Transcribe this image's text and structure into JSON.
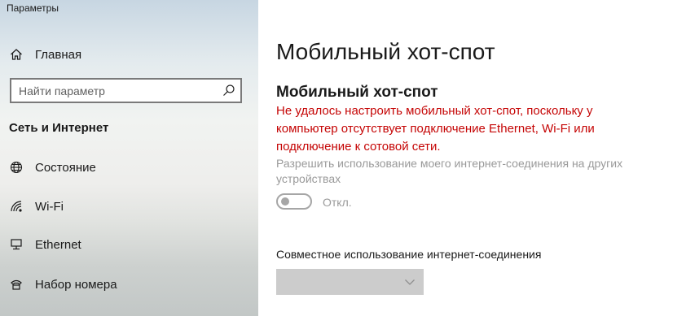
{
  "window": {
    "title": "Параметры"
  },
  "sidebar": {
    "home_label": "Главная",
    "search": {
      "placeholder": "Найти параметр",
      "value": ""
    },
    "section_heading": "Сеть и Интернет",
    "items": [
      {
        "label": "Состояние",
        "icon": "globe-icon"
      },
      {
        "label": "Wi-Fi",
        "icon": "wifi-icon"
      },
      {
        "label": "Ethernet",
        "icon": "ethernet-icon"
      },
      {
        "label": "Набор номера",
        "icon": "dialup-icon"
      }
    ]
  },
  "main": {
    "page_title": "Мобильный хот-спот",
    "section_title": "Мобильный хот-спот",
    "error_message": "Не удалось настроить мобильный хот-спот, поскольку у компьютер отсутствует подключение Ethernet, Wi-Fi или подключение к сотовой сети.",
    "share_description": "Разрешить использование моего интернет-соединения на других устройствах",
    "toggle": {
      "state_label": "Откл.",
      "on": false,
      "enabled": false
    },
    "ics_label": "Совместное использование интернет-соединения",
    "ics_dropdown": {
      "selected": "",
      "enabled": false
    }
  },
  "colors": {
    "error": "#c50505",
    "disabled_text": "#9a9a9a",
    "dropdown_disabled": "#cccccc"
  }
}
